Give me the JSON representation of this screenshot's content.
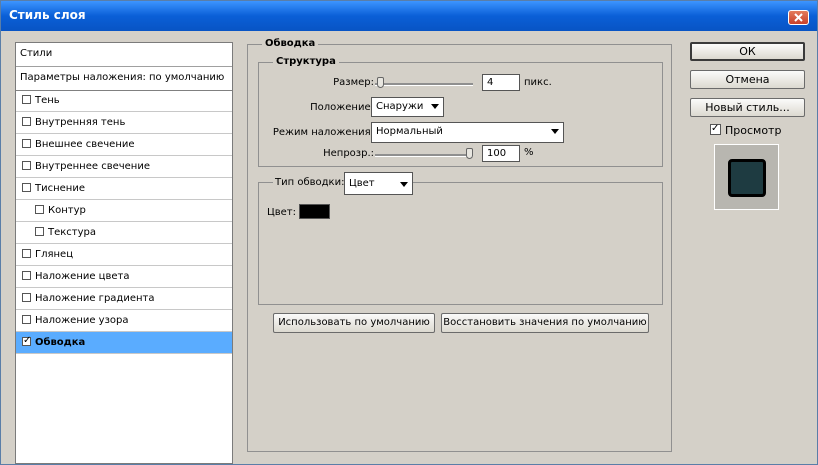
{
  "window": {
    "title": "Стиль слоя"
  },
  "sidebar": {
    "header": "Стили",
    "blend_options": "Параметры наложения: по умолчанию",
    "items": [
      {
        "label": "Тень",
        "checked": false,
        "indent": false
      },
      {
        "label": "Внутренняя тень",
        "checked": false,
        "indent": false
      },
      {
        "label": "Внешнее свечение",
        "checked": false,
        "indent": false
      },
      {
        "label": "Внутреннее свечение",
        "checked": false,
        "indent": false
      },
      {
        "label": "Тиснение",
        "checked": false,
        "indent": false
      },
      {
        "label": "Контур",
        "checked": false,
        "indent": true
      },
      {
        "label": "Текстура",
        "checked": false,
        "indent": true
      },
      {
        "label": "Глянец",
        "checked": false,
        "indent": false
      },
      {
        "label": "Наложение цвета",
        "checked": false,
        "indent": false
      },
      {
        "label": "Наложение градиента",
        "checked": false,
        "indent": false
      },
      {
        "label": "Наложение узора",
        "checked": false,
        "indent": false
      },
      {
        "label": "Обводка",
        "checked": true,
        "indent": false,
        "selected": true
      }
    ]
  },
  "panel": {
    "title": "Обводка",
    "structure": {
      "title": "Структура",
      "size_label": "Размер:",
      "size_value": "4",
      "size_unit": "пикс.",
      "size_fraction": 0.02,
      "position_label": "Положение:",
      "position_value": "Снаружи",
      "blend_label": "Режим наложения:",
      "blend_value": "Нормальный",
      "opacity_label": "Непрозр.:",
      "opacity_value": "100",
      "opacity_unit": "%",
      "opacity_fraction": 1.0
    },
    "fill": {
      "type_label": "Тип обводки:",
      "type_value": "Цвет",
      "color_label": "Цвет:",
      "color": "#000000"
    },
    "make_default": "Использовать по умолчанию",
    "reset_default": "Восстановить значения по умолчанию"
  },
  "buttons": {
    "ok": "ОК",
    "cancel": "Отмена",
    "new_style": "Новый стиль...",
    "preview_label": "Просмотр",
    "preview_checked": true
  },
  "preview": {
    "fill_color": "#1e3b41"
  }
}
